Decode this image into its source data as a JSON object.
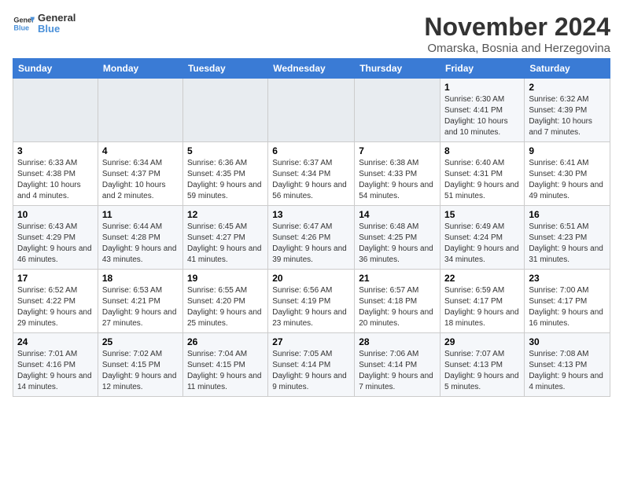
{
  "logo": {
    "text_general": "General",
    "text_blue": "Blue"
  },
  "header": {
    "month": "November 2024",
    "location": "Omarska, Bosnia and Herzegovina"
  },
  "weekdays": [
    "Sunday",
    "Monday",
    "Tuesday",
    "Wednesday",
    "Thursday",
    "Friday",
    "Saturday"
  ],
  "weeks": [
    [
      {
        "day": "",
        "info": ""
      },
      {
        "day": "",
        "info": ""
      },
      {
        "day": "",
        "info": ""
      },
      {
        "day": "",
        "info": ""
      },
      {
        "day": "",
        "info": ""
      },
      {
        "day": "1",
        "info": "Sunrise: 6:30 AM\nSunset: 4:41 PM\nDaylight: 10 hours and 10 minutes."
      },
      {
        "day": "2",
        "info": "Sunrise: 6:32 AM\nSunset: 4:39 PM\nDaylight: 10 hours and 7 minutes."
      }
    ],
    [
      {
        "day": "3",
        "info": "Sunrise: 6:33 AM\nSunset: 4:38 PM\nDaylight: 10 hours and 4 minutes."
      },
      {
        "day": "4",
        "info": "Sunrise: 6:34 AM\nSunset: 4:37 PM\nDaylight: 10 hours and 2 minutes."
      },
      {
        "day": "5",
        "info": "Sunrise: 6:36 AM\nSunset: 4:35 PM\nDaylight: 9 hours and 59 minutes."
      },
      {
        "day": "6",
        "info": "Sunrise: 6:37 AM\nSunset: 4:34 PM\nDaylight: 9 hours and 56 minutes."
      },
      {
        "day": "7",
        "info": "Sunrise: 6:38 AM\nSunset: 4:33 PM\nDaylight: 9 hours and 54 minutes."
      },
      {
        "day": "8",
        "info": "Sunrise: 6:40 AM\nSunset: 4:31 PM\nDaylight: 9 hours and 51 minutes."
      },
      {
        "day": "9",
        "info": "Sunrise: 6:41 AM\nSunset: 4:30 PM\nDaylight: 9 hours and 49 minutes."
      }
    ],
    [
      {
        "day": "10",
        "info": "Sunrise: 6:43 AM\nSunset: 4:29 PM\nDaylight: 9 hours and 46 minutes."
      },
      {
        "day": "11",
        "info": "Sunrise: 6:44 AM\nSunset: 4:28 PM\nDaylight: 9 hours and 43 minutes."
      },
      {
        "day": "12",
        "info": "Sunrise: 6:45 AM\nSunset: 4:27 PM\nDaylight: 9 hours and 41 minutes."
      },
      {
        "day": "13",
        "info": "Sunrise: 6:47 AM\nSunset: 4:26 PM\nDaylight: 9 hours and 39 minutes."
      },
      {
        "day": "14",
        "info": "Sunrise: 6:48 AM\nSunset: 4:25 PM\nDaylight: 9 hours and 36 minutes."
      },
      {
        "day": "15",
        "info": "Sunrise: 6:49 AM\nSunset: 4:24 PM\nDaylight: 9 hours and 34 minutes."
      },
      {
        "day": "16",
        "info": "Sunrise: 6:51 AM\nSunset: 4:23 PM\nDaylight: 9 hours and 31 minutes."
      }
    ],
    [
      {
        "day": "17",
        "info": "Sunrise: 6:52 AM\nSunset: 4:22 PM\nDaylight: 9 hours and 29 minutes."
      },
      {
        "day": "18",
        "info": "Sunrise: 6:53 AM\nSunset: 4:21 PM\nDaylight: 9 hours and 27 minutes."
      },
      {
        "day": "19",
        "info": "Sunrise: 6:55 AM\nSunset: 4:20 PM\nDaylight: 9 hours and 25 minutes."
      },
      {
        "day": "20",
        "info": "Sunrise: 6:56 AM\nSunset: 4:19 PM\nDaylight: 9 hours and 23 minutes."
      },
      {
        "day": "21",
        "info": "Sunrise: 6:57 AM\nSunset: 4:18 PM\nDaylight: 9 hours and 20 minutes."
      },
      {
        "day": "22",
        "info": "Sunrise: 6:59 AM\nSunset: 4:17 PM\nDaylight: 9 hours and 18 minutes."
      },
      {
        "day": "23",
        "info": "Sunrise: 7:00 AM\nSunset: 4:17 PM\nDaylight: 9 hours and 16 minutes."
      }
    ],
    [
      {
        "day": "24",
        "info": "Sunrise: 7:01 AM\nSunset: 4:16 PM\nDaylight: 9 hours and 14 minutes."
      },
      {
        "day": "25",
        "info": "Sunrise: 7:02 AM\nSunset: 4:15 PM\nDaylight: 9 hours and 12 minutes."
      },
      {
        "day": "26",
        "info": "Sunrise: 7:04 AM\nSunset: 4:15 PM\nDaylight: 9 hours and 11 minutes."
      },
      {
        "day": "27",
        "info": "Sunrise: 7:05 AM\nSunset: 4:14 PM\nDaylight: 9 hours and 9 minutes."
      },
      {
        "day": "28",
        "info": "Sunrise: 7:06 AM\nSunset: 4:14 PM\nDaylight: 9 hours and 7 minutes."
      },
      {
        "day": "29",
        "info": "Sunrise: 7:07 AM\nSunset: 4:13 PM\nDaylight: 9 hours and 5 minutes."
      },
      {
        "day": "30",
        "info": "Sunrise: 7:08 AM\nSunset: 4:13 PM\nDaylight: 9 hours and 4 minutes."
      }
    ]
  ]
}
